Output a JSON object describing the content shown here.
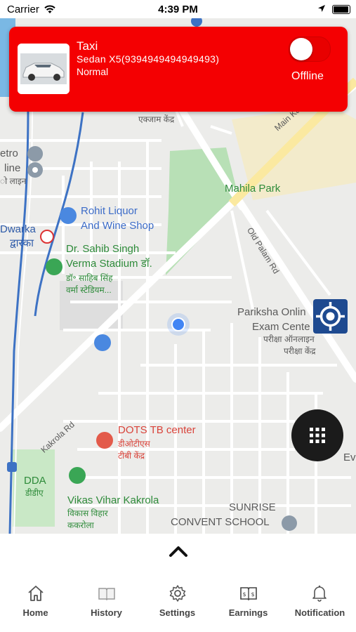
{
  "status_bar": {
    "carrier": "Carrier",
    "time": "4:39 PM"
  },
  "taxi_card": {
    "title": "Taxi",
    "vehicle": "Sedan X5(9394949494949493)",
    "mode": "Normal",
    "status_label": "Offline",
    "toggle_on": false
  },
  "map": {
    "labels": {
      "metro_1": "etro",
      "metro_2": "line",
      "metro_3": "ो लाइन",
      "dwarka": "Dwarka",
      "dwarka_hi": "द्वारका",
      "ekjam": "एक्जाम केंद्र",
      "main_road": "Main Ka",
      "mahila_park": "Mahila Park",
      "rohit_1": "Rohit Liquor",
      "rohit_2": "And Wine Shop",
      "stadium_1": "Dr. Sahib Singh",
      "stadium_2": "Verma Stadium डॉ.",
      "stadium_3": "डॉ॰ साहिब सिंह",
      "stadium_4": "वर्मा स्टेडियम...",
      "old_palam": "Old Palam Rd",
      "pariksha_1": "Pariksha Onlin",
      "pariksha_2": "Exam Cente",
      "pariksha_3": "परीक्षा ऑनलाइन",
      "pariksha_4": "परीक्षा केंद्र",
      "kakrola_rd": "Kakrola Rd",
      "dots_1": "DOTS TB center",
      "dots_2": "डीओटीएस",
      "dots_3": "टीबी केंद्र",
      "dda_1": "DDA",
      "dda_2": "डीडीए",
      "vikas_1": "Vikas Vihar Kakrola",
      "vikas_2": "विकास विहार",
      "vikas_3": "ककरोला",
      "sunrise_1": "SUNRISE",
      "sunrise_2": "CONVENT SCHOOL",
      "eve": "Eve"
    }
  },
  "tabs": [
    {
      "label": "Home",
      "icon": "home-icon"
    },
    {
      "label": "History",
      "icon": "book-icon"
    },
    {
      "label": "Settings",
      "icon": "gear-icon"
    },
    {
      "label": "Earnings",
      "icon": "earnings-book-icon"
    },
    {
      "label": "Notification",
      "icon": "bell-icon"
    }
  ],
  "colors": {
    "accent": "#f40002",
    "locate_button": "#1e4a90",
    "grid_button": "#1b1b1b"
  }
}
